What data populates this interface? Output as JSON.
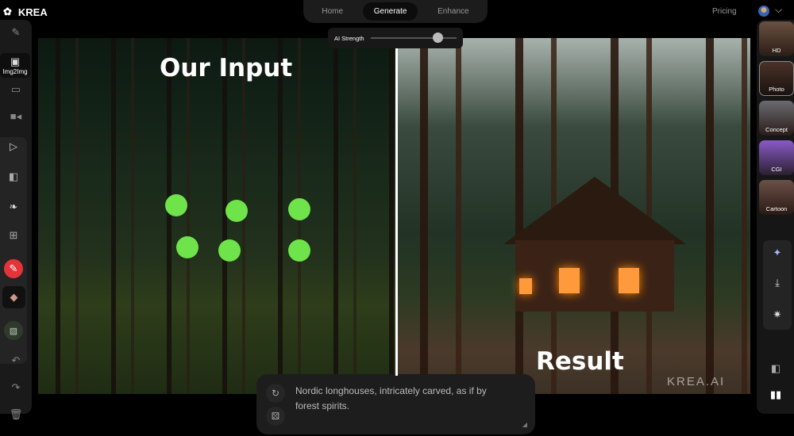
{
  "app": {
    "name": "KREA"
  },
  "nav": {
    "tabs": [
      {
        "label": "Home"
      },
      {
        "label": "Generate",
        "active": true
      },
      {
        "label": "Enhance"
      }
    ]
  },
  "ai_strength": {
    "label": "AI Strength",
    "value_fraction": 0.78
  },
  "header": {
    "pricing": "Pricing"
  },
  "left_sidebar": {
    "items": [
      {
        "icon": "text-to-image-icon"
      },
      {
        "icon": "image-icon",
        "label": "Img2Img"
      },
      {
        "icon": "screen-icon"
      },
      {
        "icon": "video-camera-icon"
      }
    ],
    "tools": [
      "pointer-icon",
      "layers-icon",
      "feather-brush-icon",
      "add-image-icon",
      "pencil-icon",
      "eraser-icon",
      "background-image-icon"
    ],
    "bottom": [
      "undo-icon",
      "redo-icon",
      "trash-icon"
    ]
  },
  "canvas": {
    "input_label": "Our Input",
    "result_label": "Result",
    "watermark": "KREA.AI",
    "accent": "#6ee34a"
  },
  "styles": [
    {
      "label": "HD"
    },
    {
      "label": "Photo",
      "selected": true
    },
    {
      "label": "Concept"
    },
    {
      "label": "CGI"
    },
    {
      "label": "Cartoon"
    }
  ],
  "right_actions": [
    "sparkles-icon",
    "download-icon",
    "upscale-icon",
    "layers-icon",
    "split-view-icon"
  ],
  "prompt": {
    "text": "Nordic longhouses, intricately carved, as if by forest spirits."
  }
}
